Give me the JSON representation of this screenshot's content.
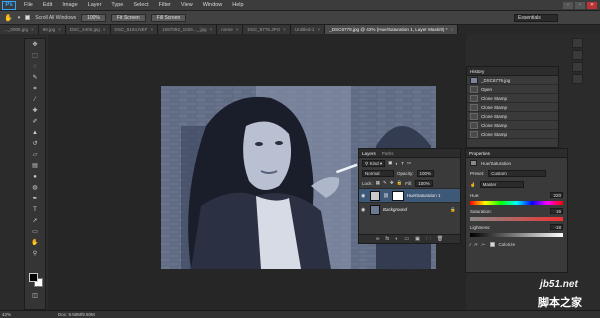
{
  "menubar": {
    "logo": "Ps",
    "items": [
      "File",
      "Edit",
      "Image",
      "Layer",
      "Type",
      "Select",
      "Filter",
      "View",
      "Window",
      "Help"
    ],
    "window_controls": [
      "-",
      "▫",
      "✕"
    ]
  },
  "options": {
    "scroll_all_windows": "Scroll All Windows",
    "zoom_100": "100%",
    "fit_screen": "Fit Screen",
    "fill_screen": "Fill Screen",
    "workspace": "Essentials"
  },
  "tabs": [
    {
      "label": "..._0005.jpg"
    },
    {
      "label": "86.jpg"
    },
    {
      "label": "DSC_4405.jpg"
    },
    {
      "label": "DSC_8164.NEF"
    },
    {
      "label": "1067092_1026..._.jpg"
    },
    {
      "label": "nome"
    },
    {
      "label": "DSC_8776.JPG"
    },
    {
      "label": "Untitled-1"
    },
    {
      "label": "_DSC6779.jpg @ 42% (Hue/Saturation 1, Layer Mask/8) *"
    }
  ],
  "status": {
    "zoom": "42%",
    "doc": "Doc: 9.50M/9.50M"
  },
  "history": {
    "title": "History",
    "snapshot": "_DSC6779.jpg",
    "items": [
      "Open",
      "Clone Stamp",
      "Clone Stamp",
      "Clone Stamp",
      "Clone Stamp",
      "Clone Stamp"
    ]
  },
  "layers": {
    "tab_layers": "Layers",
    "tab_paths": "Paths",
    "kind": "Kind",
    "blend_mode": "Normal",
    "opacity_label": "Opacity:",
    "opacity": "100%",
    "lock_label": "Lock:",
    "fill_label": "Fill:",
    "fill": "100%",
    "rows": [
      {
        "name": "Hue/Saturation 1"
      },
      {
        "name": "Background"
      }
    ],
    "footer_icons": [
      "∞",
      "fx",
      "◐",
      "▭",
      "▣",
      "🗀",
      "🗑"
    ]
  },
  "properties": {
    "title": "Properties",
    "adjustment": "Hue/Saturation",
    "preset_label": "Preset:",
    "preset_value": "Custom",
    "channel": "Master",
    "hue_label": "Hue:",
    "hue_value": "220",
    "saturation_label": "Saturation:",
    "saturation_value": "16",
    "lightness_label": "Lightness:",
    "lightness_value": "-18",
    "colorize_label": "Colorize"
  },
  "watermark": {
    "url": "jb51.net",
    "cn": "脚本之家"
  }
}
